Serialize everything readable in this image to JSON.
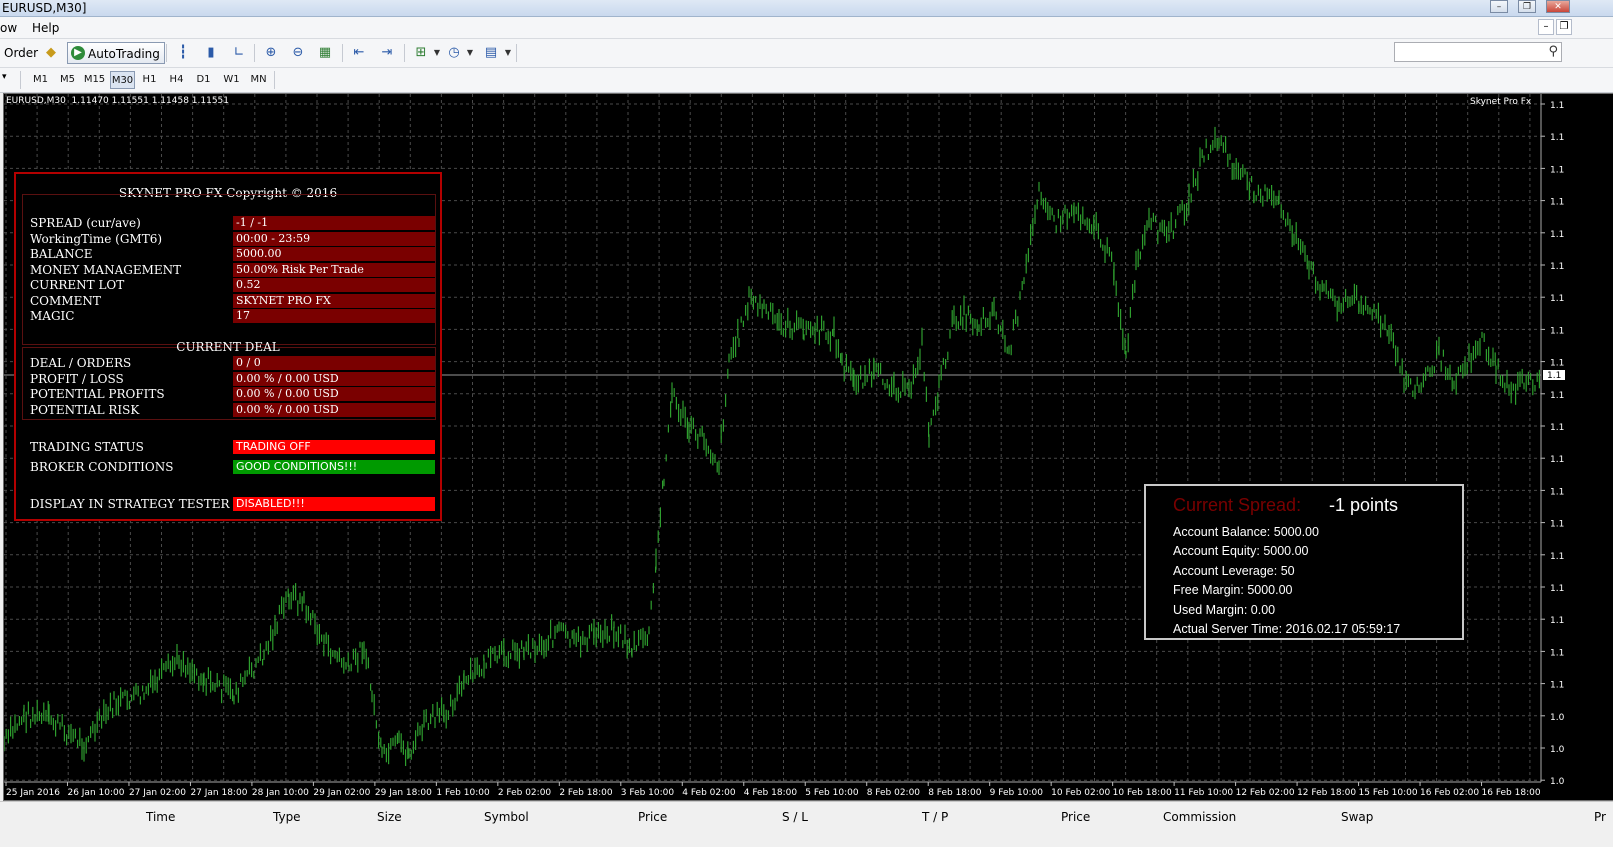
{
  "window": {
    "title": "EURUSD,M30]"
  },
  "menu": {
    "items": [
      "ow",
      "Help"
    ]
  },
  "toolbar": {
    "order_label": "Order",
    "autotrading_label": "AutoTrading"
  },
  "timeframes": [
    "M1",
    "M5",
    "M15",
    "M30",
    "H1",
    "H4",
    "D1",
    "W1",
    "MN"
  ],
  "active_timeframe": "M30",
  "chart": {
    "info": "EURUSD,M30  1.11470 1.11551 1.11458 1.11551",
    "brand": "Skynet Pro Fx",
    "axis_labels": [
      "1.1",
      "1.1",
      "1.1",
      "1.1",
      "1.1",
      "1.1",
      "1.1",
      "1.1",
      "1.1",
      "1.1",
      "1.1",
      "1.1",
      "1.1",
      "1.1",
      "1.1",
      "1.1",
      "1.1",
      "1.1",
      "1.1",
      "1.0",
      "1.0",
      "1.0",
      "1.0"
    ],
    "current_price_label": "1.1",
    "x_labels": [
      "25 Jan 2016",
      "26 Jan 10:00",
      "27 Jan 02:00",
      "27 Jan 18:00",
      "28 Jan 10:00",
      "29 Jan 02:00",
      "29 Jan 18:00",
      "1 Feb 10:00",
      "2 Feb 02:00",
      "2 Feb 18:00",
      "3 Feb 10:00",
      "4 Feb 02:00",
      "4 Feb 18:00",
      "5 Feb 10:00",
      "8 Feb 02:00",
      "8 Feb 18:00",
      "9 Feb 10:00",
      "10 Feb 02:00",
      "10 Feb 18:00",
      "11 Feb 10:00",
      "12 Feb 02:00",
      "12 Feb 18:00",
      "15 Feb 10:00",
      "16 Feb 02:00",
      "16 Feb 18:00"
    ],
    "candle_color": "#2e9e2e",
    "grid_color": "#4a4a4a"
  },
  "panel": {
    "title": "SKYNET PRO FX Copyright © 2016",
    "rows": [
      {
        "label": "SPREAD (cur/ave)",
        "value": "-1 / -1"
      },
      {
        "label": "WorkingTime (GMT6)",
        "value": "00:00 - 23:59"
      },
      {
        "label": "BALANCE",
        "value": "5000.00"
      },
      {
        "label": "MONEY MANAGEMENT",
        "value": "50.00% Risk Per Trade"
      },
      {
        "label": "CURRENT LOT",
        "value": "0.52"
      },
      {
        "label": "COMMENT",
        "value": "SKYNET PRO FX"
      },
      {
        "label": "MAGIC",
        "value": "17"
      }
    ],
    "current_deal_title": "CURRENT DEAL",
    "deal_rows": [
      {
        "label": "DEAL / ORDERS",
        "value": "0 / 0"
      },
      {
        "label": "PROFIT / LOSS",
        "value": "0.00 % / 0.00 USD"
      },
      {
        "label": "POTENTIAL PROFITS",
        "value": "0.00 % / 0.00 USD"
      },
      {
        "label": "POTENTIAL RISK",
        "value": "0.00 % / 0.00 USD"
      }
    ],
    "trading_status_label": "TRADING STATUS",
    "trading_status_value": "TRADING OFF",
    "broker_label": "BROKER CONDITIONS",
    "broker_value": "GOOD CONDITIONS!!!",
    "display_label": "DISPLAY IN STRATEGY TESTER IS",
    "display_value": "DISABLED!!!",
    "colors": {
      "value_bg": "#7a0000",
      "alert": "#ff0000",
      "ok": "#009a00",
      "border": "#b30000"
    }
  },
  "spread_box": {
    "spread_label": "Current Spread:",
    "spread_value": "-1 points",
    "lines": [
      "Account Balance:  5000.00",
      "Account Equity:  5000.00",
      "Account Leverage:  50",
      "Free Margin:  5000.00",
      "Used Margin:  0.00",
      "Actual Server Time:  2016.02.17 05:59:17"
    ]
  },
  "columns": [
    "Time",
    "Type",
    "Size",
    "Symbol",
    "Price",
    "S / L",
    "T / P",
    "Price",
    "Commission",
    "Swap",
    "Pr"
  ]
}
